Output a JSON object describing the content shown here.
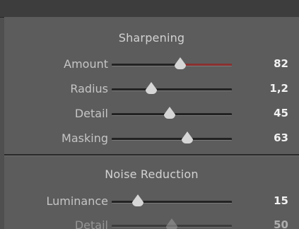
{
  "sharpening": {
    "title": "Sharpening",
    "sliders": [
      {
        "label": "Amount",
        "value": "82",
        "level": 0.57,
        "track_accent": "#8a3030"
      },
      {
        "label": "Radius",
        "value": "1,2",
        "level": 0.33
      },
      {
        "label": "Detail",
        "value": "45",
        "level": 0.48
      },
      {
        "label": "Masking",
        "value": "63",
        "level": 0.63
      }
    ]
  },
  "noise_reduction": {
    "title": "Noise Reduction",
    "sliders": [
      {
        "label": "Luminance",
        "value": "15",
        "level": 0.22
      },
      {
        "label": "Detail",
        "value": "50",
        "level": 0.5
      }
    ]
  },
  "colors": {
    "panel": "#5c5c5c",
    "text": "#c5c5c5",
    "value_text": "#f2f2f2",
    "accent": "#8a3030"
  }
}
